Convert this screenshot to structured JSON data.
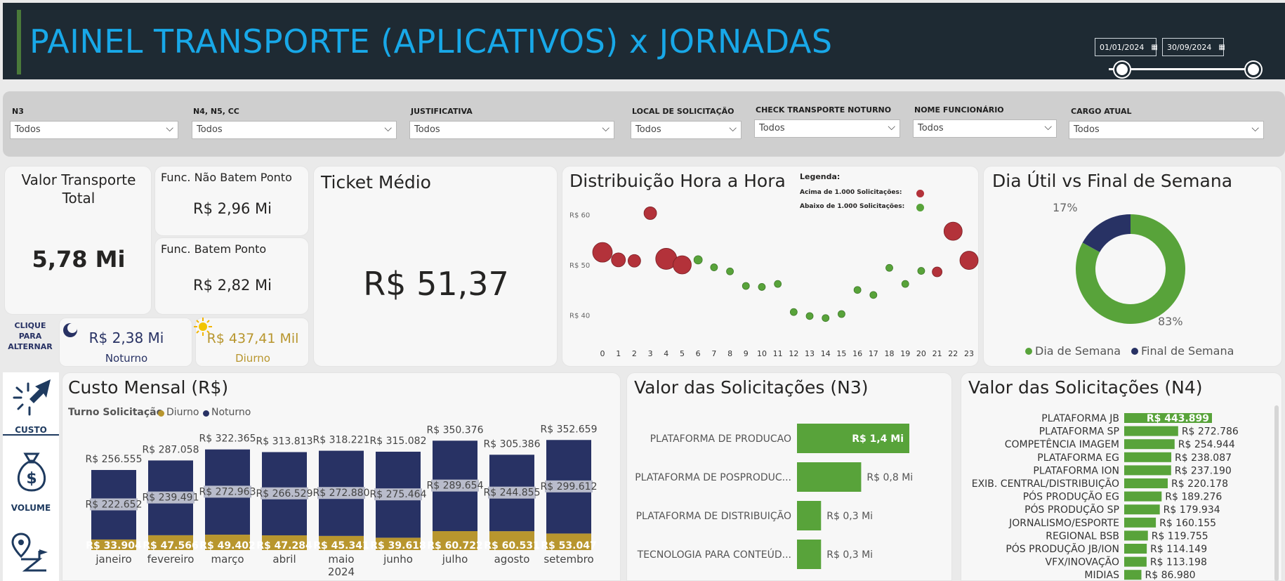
{
  "header": {
    "title": "PAINEL TRANSPORTE (APLICATIVOS) x JORNADAS",
    "date_start": "01/01/2024",
    "date_end": "30/09/2024"
  },
  "filters": [
    {
      "label": "N3",
      "value": "Todos"
    },
    {
      "label": "N4, N5, CC",
      "value": "Todos"
    },
    {
      "label": "JUSTIFICATIVA",
      "value": "Todos"
    },
    {
      "label": "LOCAL DE SOLICITAÇÃO",
      "value": "Todos"
    },
    {
      "label": "CHECK TRANSPORTE NOTURNO",
      "value": "Todos"
    },
    {
      "label": "NOME FUNCIONÁRIO",
      "value": "Todos"
    },
    {
      "label": "CARGO ATUAL",
      "value": "Todos"
    }
  ],
  "kpis": {
    "total_label": "Valor Transporte Total",
    "total_value": "5,78 Mi",
    "nao_batem_label": "Func. Não Batem Ponto",
    "nao_batem_value": "R$ 2,96 Mi",
    "batem_label": "Func. Batem Ponto",
    "batem_value": "R$ 2,82 Mi",
    "toggle_label": "CLIQUE PARA ALTERNAR",
    "noturno_value": "R$ 2,38 Mi",
    "noturno_label": "Noturno",
    "diurno_value": "R$ 437,41 Mil",
    "diurno_label": "Diurno",
    "ticket_label": "Ticket Médio",
    "ticket_value": "R$ 51,37"
  },
  "colors": {
    "noturno": "#283264",
    "diurno": "#b8962e",
    "green": "#58a33a",
    "red": "#b3323a",
    "accent": "#18a8e8"
  },
  "nav": {
    "custo": "CUSTO",
    "volume": "VOLUME"
  },
  "chart_data": [
    {
      "type": "scatter",
      "title": "Distribuição Hora a Hora",
      "legend_title": "Legenda:",
      "legend": [
        "Acima de 1.000 Solicitações:",
        "Abaixo de 1.000 Solicitações:"
      ],
      "y_ticks": [
        "R$ 60",
        "R$ 50",
        "R$ 40"
      ],
      "ylim": [
        36,
        64
      ],
      "x": [
        0,
        1,
        2,
        3,
        4,
        5,
        6,
        7,
        8,
        9,
        10,
        11,
        12,
        13,
        14,
        15,
        16,
        17,
        18,
        19,
        20,
        21,
        22,
        23
      ],
      "y": [
        52.5,
        51,
        50.8,
        60.3,
        51.2,
        50,
        51,
        49.5,
        48.7,
        45.8,
        45.6,
        46.2,
        40.6,
        39.8,
        39.4,
        40.2,
        45,
        44,
        49.4,
        46.2,
        48.8,
        48.6,
        56.7,
        50.9
      ],
      "above_1000": [
        true,
        true,
        true,
        true,
        true,
        true,
        false,
        false,
        false,
        false,
        false,
        false,
        false,
        false,
        false,
        false,
        false,
        false,
        false,
        false,
        false,
        true,
        true,
        true
      ],
      "size": [
        14,
        10,
        9,
        9,
        15,
        13,
        6,
        5,
        5,
        5,
        5,
        5,
        5,
        5,
        5,
        5,
        5,
        5,
        5,
        5,
        5,
        7,
        13,
        13
      ]
    },
    {
      "type": "pie",
      "title": "Dia Útil vs Final de Semana",
      "labels": [
        "Dia de Semana",
        "Final de Semana"
      ],
      "values": [
        83,
        17
      ],
      "value_labels": [
        "83%",
        "17%"
      ]
    },
    {
      "type": "bar",
      "title": "Custo Mensal (R$)",
      "legend_title": "Turno Solicitação",
      "categories": [
        "janeiro",
        "fevereiro",
        "março",
        "abril",
        "maio",
        "junho",
        "julho",
        "agosto",
        "setembro"
      ],
      "year_label": "2024",
      "totals": [
        "R$ 256.555",
        "R$ 287.058",
        "R$ 322.365",
        "R$ 313.813",
        "R$ 318.221",
        "R$ 315.082",
        "R$ 350.376",
        "R$ 305.386",
        "R$ 352.659"
      ],
      "series": [
        {
          "name": "Diurno",
          "values": [
            33904,
            47566,
            49402,
            47284,
            45341,
            39618,
            60722,
            60531,
            53047
          ],
          "labels": [
            "R$ 33.904",
            "R$ 47.566",
            "R$ 49.402",
            "R$ 47.284",
            "R$ 45.341",
            "R$ 39.618",
            "R$ 60.722",
            "R$ 60.531",
            "R$ 53.047"
          ]
        },
        {
          "name": "Noturno",
          "values": [
            222652,
            239491,
            272963,
            266529,
            272880,
            275464,
            289654,
            244855,
            299612
          ],
          "labels": [
            "R$ 222.652",
            "R$ 239.491",
            "R$ 272.963",
            "R$ 266.529",
            "R$ 272.880",
            "R$ 275.464",
            "R$ 289.654",
            "R$ 244.855",
            "R$ 299.612"
          ]
        }
      ]
    },
    {
      "type": "bar",
      "title": "Valor das Solicitações (N3)",
      "categories": [
        "PLATAFORMA DE PRODUCAO",
        "PLATAFORMA DE POSPRODUC...",
        "PLATAFORMA DE DISTRIBUIÇÃO",
        "TECNOLOGIA PARA CONTEÚD..."
      ],
      "values": [
        1.4,
        0.8,
        0.3,
        0.3
      ],
      "labels": [
        "R$ 1,4 Mi",
        "R$ 0,8 Mi",
        "R$ 0,3 Mi",
        "R$ 0,3 Mi"
      ]
    },
    {
      "type": "bar",
      "title": "Valor das Solicitações (N4)",
      "categories": [
        "PLATAFORMA JB",
        "PLATAFORMA SP",
        "COMPETÊNCIA IMAGEM",
        "PLATAFORMA EG",
        "PLATAFORMA ION",
        "EXIB. CENTRAL/DISTRIBUIÇÃO",
        "PÓS PRODUÇÃO EG",
        "PÓS PRODUÇÃO SP",
        "JORNALISMO/ESPORTE",
        "REGIONAL BSB",
        "PÓS PRODUÇÃO JB/ION",
        "VFX/INOVAÇÃO",
        "MIDIAS"
      ],
      "values": [
        443899,
        272786,
        254944,
        238087,
        237190,
        220178,
        189276,
        179934,
        160155,
        119755,
        114149,
        113198,
        86980
      ],
      "labels": [
        "R$ 443.899",
        "R$ 272.786",
        "R$ 254.944",
        "R$ 238.087",
        "R$ 237.190",
        "R$ 220.178",
        "R$ 189.276",
        "R$ 179.934",
        "R$ 160.155",
        "R$ 119.755",
        "R$ 114.149",
        "R$ 113.198",
        "R$ 86.980"
      ]
    }
  ]
}
